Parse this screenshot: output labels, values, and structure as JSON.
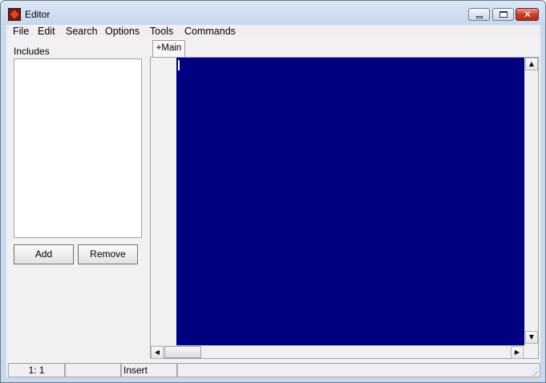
{
  "window": {
    "title": "Editor",
    "icon": "app-icon",
    "controls": {
      "minimize": "minimize-icon",
      "maximize": "maximize-icon",
      "close_glyph": "✕"
    }
  },
  "menu": [
    "File",
    "Edit",
    "Search",
    "Options",
    "Tools",
    "Commands"
  ],
  "includes": {
    "label": "Includes",
    "items": [],
    "add_label": "Add",
    "remove_label": "Remove"
  },
  "editor": {
    "tabs": [
      {
        "label": "+Main",
        "active": true
      }
    ],
    "background_color": "#000080",
    "content": ""
  },
  "scrollbar": {
    "up": "▲",
    "down": "▼",
    "left": "◀",
    "right": "▶"
  },
  "status": {
    "position": "1: 1",
    "modified": "",
    "mode": "Insert",
    "message": ""
  }
}
